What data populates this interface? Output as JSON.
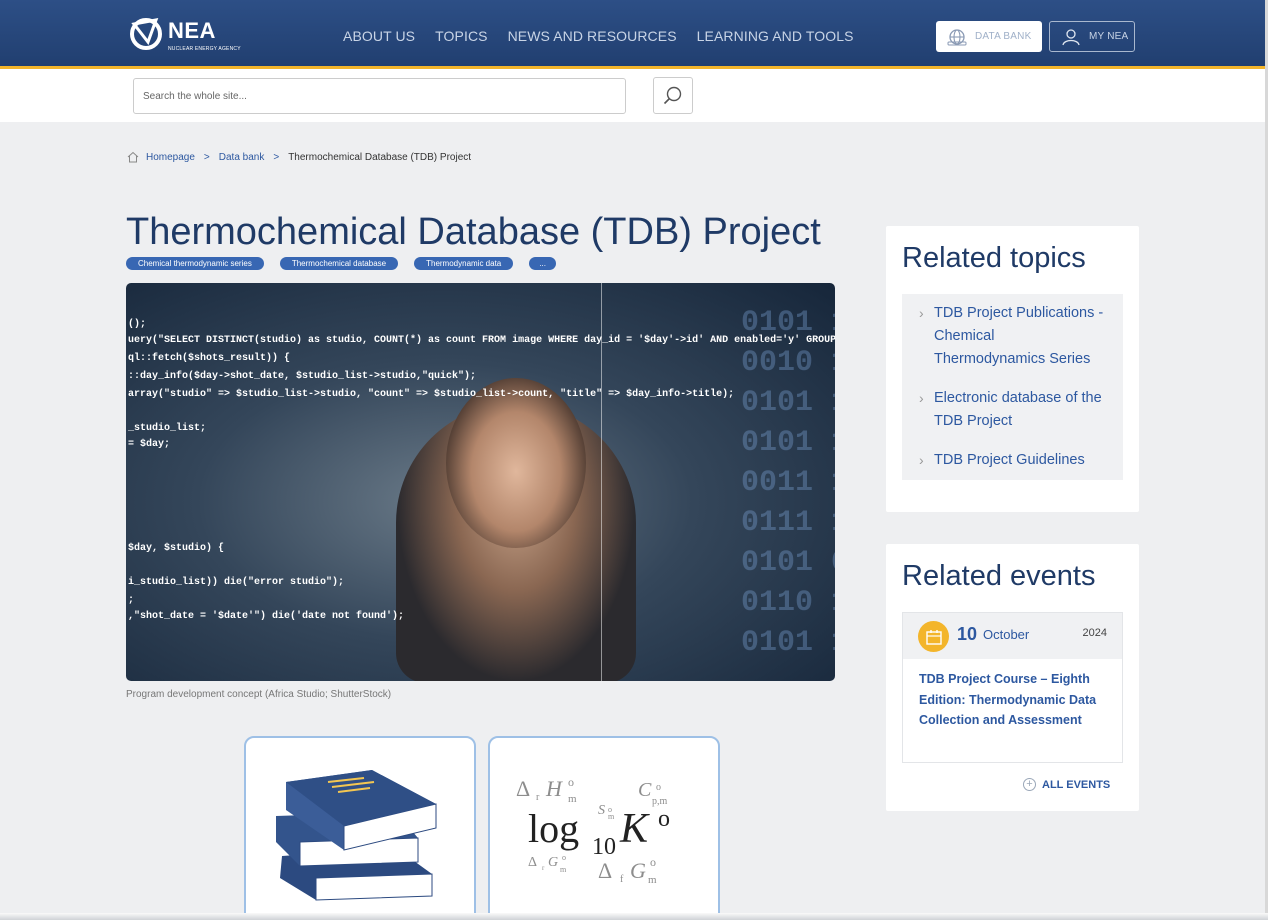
{
  "header": {
    "logo_text": "NEA",
    "logo_sub": "NUCLEAR ENERGY AGENCY",
    "nav": [
      "ABOUT US",
      "TOPICS",
      "NEWS AND RESOURCES",
      "LEARNING AND TOOLS"
    ],
    "databank_label": "DATA BANK",
    "mynea_label": "MY NEA"
  },
  "search": {
    "placeholder": "Search the whole site..."
  },
  "breadcrumb": {
    "home": "Homepage",
    "databank": "Data bank",
    "current": "Thermochemical Database (TDB) Project"
  },
  "main": {
    "title": "Thermochemical Database (TDB) Project",
    "tags": [
      "Chemical thermodynamic series",
      "Thermochemical database",
      "Thermodynamic data",
      "..."
    ],
    "caption": "Program development concept (Africa Studio; ShutterStock)"
  },
  "related_topics": {
    "heading": "Related topics",
    "items": [
      "TDB Project Publications - Chemical Thermodynamics Series",
      "Electronic database of the TDB Project",
      "TDB Project Guidelines"
    ]
  },
  "related_events": {
    "heading": "Related events",
    "event": {
      "day": "10",
      "month": "October",
      "year": "2024",
      "title": "TDB Project Course – Eighth Edition: Thermodynamic Data Collection and Assessment"
    },
    "all_label": "ALL EVENTS"
  },
  "colors": {
    "header": "#2d4f86",
    "accent": "#f3b52b",
    "link": "#2d58a0",
    "tag": "#3867b3"
  }
}
